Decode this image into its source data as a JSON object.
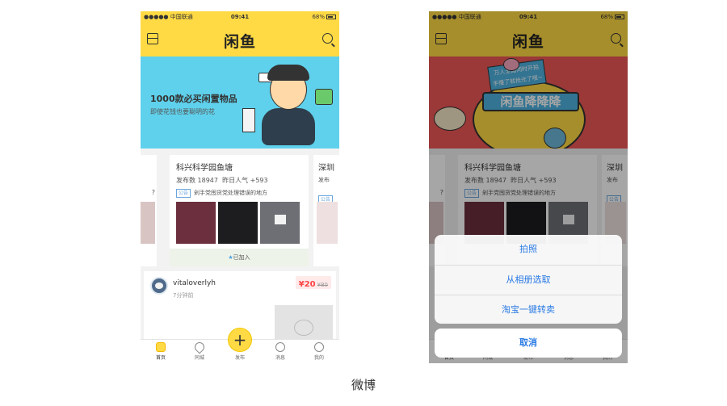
{
  "status_bar": {
    "carrier": "●●●●● 中国联通",
    "time": "09:41",
    "battery": "68%"
  },
  "app": {
    "logo": "闲鱼"
  },
  "banner_left": {
    "title": "1000款必买闲置物品",
    "subtitle": "即使花钱也要聪明的花"
  },
  "banner_right": {
    "tag_line1": "万人全国同时开拍",
    "tag_line2": "手慢了就抢光了哦~",
    "title": "闲鱼降降降"
  },
  "pond_card": {
    "title": "科兴科学园鱼塘",
    "posts": "发布数 18947",
    "popularity": "昨日人气 +593",
    "notice_tag": "公告",
    "notice_text": "剁手党囤货党处理错误的地方",
    "joined": "已加入"
  },
  "side_cards": {
    "left_hint": "?",
    "right_title": "深圳",
    "right_stat": "发布",
    "right_tag": "公告"
  },
  "feed": {
    "user": "vitaloverlyh",
    "time": "7分钟前",
    "price": "¥20",
    "original_price": "¥80"
  },
  "tabs": {
    "home": "首页",
    "city": "同城",
    "publish": "发布",
    "messages": "消息",
    "mine": "我的",
    "publish_symbol": "+"
  },
  "action_sheet": {
    "take_photo": "拍照",
    "from_album": "从相册选取",
    "taobao": "淘宝一键转卖",
    "cancel": "取消"
  },
  "caption": "微博",
  "colors": {
    "brand_yellow": "#ffda44",
    "banner_blue": "#5fd1ec",
    "banner_red": "#ef5757",
    "link_blue": "#2a7ae4",
    "price_red": "#ff4444"
  }
}
